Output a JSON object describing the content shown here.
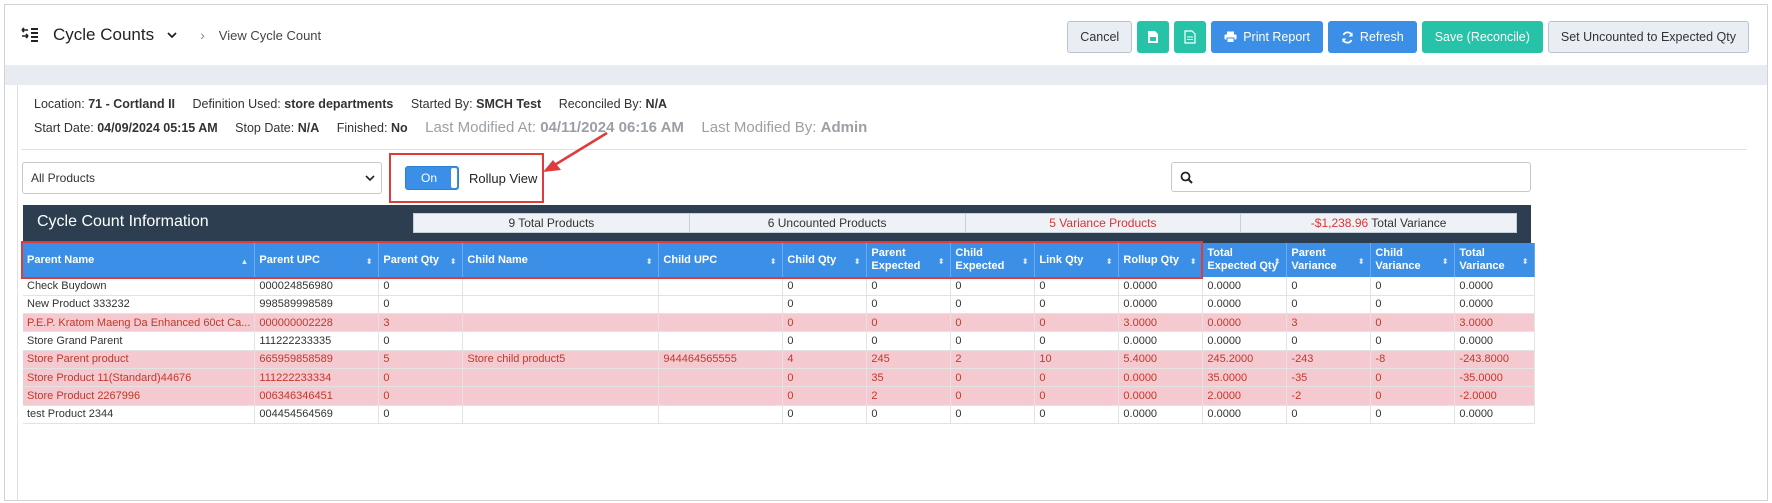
{
  "header": {
    "title": "Cycle Counts",
    "breadcrumb_sep": "›",
    "breadcrumb": "View Cycle Count"
  },
  "toolbar": {
    "cancel": "Cancel",
    "print_report": "Print Report",
    "refresh": "Refresh",
    "save_reconcile": "Save (Reconcile)",
    "set_uncounted": "Set Uncounted to Expected Qty"
  },
  "info": {
    "location_label": "Location:",
    "location_value": "71 - Cortland II",
    "definition_label": "Definition Used:",
    "definition_value": "store departments",
    "started_label": "Started By:",
    "started_value": "SMCH Test",
    "reconciled_label": "Reconciled By:",
    "reconciled_value": "N/A",
    "start_date_label": "Start Date:",
    "start_date_value": "04/09/2024 05:15 AM",
    "stop_date_label": "Stop Date:",
    "stop_date_value": "N/A",
    "finished_label": "Finished:",
    "finished_value": "No",
    "last_modified_at_label": "Last Modified At:",
    "last_modified_at_value": "04/11/2024 06:16 AM",
    "last_modified_by_label": "Last Modified By:",
    "last_modified_by_value": "Admin"
  },
  "filter": {
    "selected": "All Products"
  },
  "toggle": {
    "state": "On",
    "label": "Rollup View"
  },
  "search": {
    "placeholder": ""
  },
  "summary": {
    "title": "Cycle Count Information",
    "total_products": "9 Total Products",
    "uncounted_products": "6 Uncounted Products",
    "variance_products": "5 Variance Products",
    "total_variance_value": "-$1,238.96",
    "total_variance_label": "Total Variance"
  },
  "table": {
    "columns": [
      "Parent Name",
      "Parent UPC",
      "Parent Qty",
      "Child Name",
      "Child UPC",
      "Child Qty",
      "Parent Expected",
      "Child Expected",
      "Link Qty",
      "Rollup Qty",
      "Total Expected Qty",
      "Parent Variance",
      "Child Variance",
      "Total Variance"
    ],
    "rows": [
      {
        "variance": false,
        "cells": [
          "Check Buydown",
          "000024856980",
          "0",
          "",
          "",
          "0",
          "0",
          "0",
          "0",
          "0.0000",
          "0.0000",
          "0",
          "0",
          "0.0000"
        ]
      },
      {
        "variance": false,
        "cells": [
          "New Product 333232",
          "998589998589",
          "0",
          "",
          "",
          "0",
          "0",
          "0",
          "0",
          "0.0000",
          "0.0000",
          "0",
          "0",
          "0.0000"
        ]
      },
      {
        "variance": true,
        "cells": [
          "P.E.P. Kratom Maeng Da Enhanced 60ct Ca...",
          "000000002228",
          "3",
          "",
          "",
          "0",
          "0",
          "0",
          "0",
          "3.0000",
          "0.0000",
          "3",
          "0",
          "3.0000"
        ]
      },
      {
        "variance": false,
        "cells": [
          "Store Grand Parent",
          "111222233335",
          "0",
          "",
          "",
          "0",
          "0",
          "0",
          "0",
          "0.0000",
          "0.0000",
          "0",
          "0",
          "0.0000"
        ]
      },
      {
        "variance": true,
        "cells": [
          "Store Parent product",
          "665959858589",
          "5",
          "Store child product5",
          "944464565555",
          "4",
          "245",
          "2",
          "10",
          "5.4000",
          "245.2000",
          "-243",
          "-8",
          "-243.8000"
        ]
      },
      {
        "variance": true,
        "cells": [
          "Store Product 11(Standard)44676",
          "111222233334",
          "0",
          "",
          "",
          "0",
          "35",
          "0",
          "0",
          "0.0000",
          "35.0000",
          "-35",
          "0",
          "-35.0000"
        ]
      },
      {
        "variance": true,
        "cells": [
          "Store Product 2267996",
          "006346346451",
          "0",
          "",
          "",
          "0",
          "2",
          "0",
          "0",
          "0.0000",
          "2.0000",
          "-2",
          "0",
          "-2.0000"
        ]
      },
      {
        "variance": false,
        "cells": [
          "test Product 2344",
          "004454564569",
          "0",
          "",
          "",
          "0",
          "0",
          "0",
          "0",
          "0.0000",
          "0.0000",
          "0",
          "0",
          "0.0000"
        ]
      }
    ]
  }
}
